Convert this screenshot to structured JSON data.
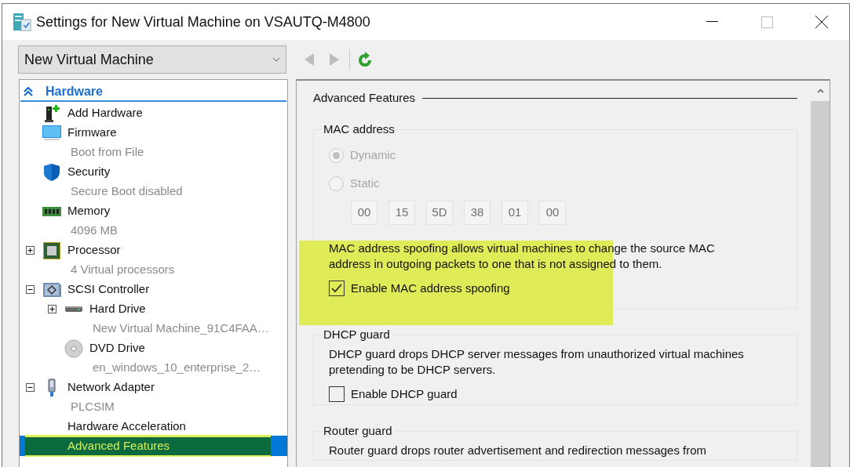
{
  "window": {
    "title": "Settings for New Virtual Machine on VSAUTQ-M4800"
  },
  "vm_selector": {
    "value": "New Virtual Machine"
  },
  "toolbar": {
    "back": {
      "disabled": true
    },
    "forward": {
      "disabled": true
    }
  },
  "tree": {
    "sections": [
      {
        "title": "Hardware",
        "expanded": true,
        "items": [
          {
            "kind": "add",
            "label": "Add Hardware",
            "selected": false
          },
          {
            "kind": "firmware",
            "label": "Firmware",
            "detail": "Boot from File",
            "selected": false
          },
          {
            "kind": "security",
            "label": "Security",
            "detail": "Secure Boot disabled",
            "selected": false
          },
          {
            "kind": "memory",
            "label": "Memory",
            "detail": "4096 MB",
            "selected": false
          },
          {
            "kind": "processor",
            "label": "Processor",
            "detail": "4 Virtual processors",
            "expanded": false,
            "selected": false
          },
          {
            "kind": "controller",
            "label": "SCSI Controller",
            "expanded": true,
            "selected": false,
            "children": [
              {
                "kind": "disk",
                "label": "Hard Drive",
                "detail": "New Virtual Machine_91C4FAA…",
                "expanded": false,
                "selected": false
              },
              {
                "kind": "dvd",
                "label": "DVD Drive",
                "detail": "en_windows_10_enterprise_2…",
                "selected": false
              }
            ]
          },
          {
            "kind": "network",
            "label": "Network Adapter",
            "detail": "PLCSIM",
            "expanded": true,
            "selected": false,
            "children": [
              {
                "kind": "feature",
                "label": "Hardware Acceleration",
                "selected": false
              },
              {
                "kind": "feature",
                "label": "Advanced Features",
                "selected": true,
                "highlighted": true
              }
            ]
          }
        ]
      }
    ]
  },
  "panel": {
    "title": "Advanced Features",
    "groups": [
      {
        "kind": "mac",
        "title": "MAC address",
        "radios": [
          {
            "label": "Dynamic",
            "selected": true,
            "disabled": true
          },
          {
            "label": "Static",
            "selected": false,
            "disabled": true
          }
        ],
        "mac_fields": [
          "00",
          "15",
          "5D",
          "38",
          "01",
          "00"
        ],
        "description": "MAC address spoofing allows virtual machines to change the source MAC address in outgoing packets to one that is not assigned to them.",
        "checkbox": {
          "label": "Enable MAC address spoofing",
          "checked": true
        },
        "highlighted": true
      },
      {
        "kind": "guard",
        "title": "DHCP guard",
        "description": "DHCP guard drops DHCP server messages from unauthorized virtual machines pretending to be DHCP servers.",
        "checkbox": {
          "label": "Enable DHCP guard",
          "checked": false
        },
        "highlighted": false
      },
      {
        "kind": "guard",
        "title": "Router guard",
        "description": "Router guard drops router advertisement and redirection messages from",
        "highlighted": false
      }
    ]
  }
}
